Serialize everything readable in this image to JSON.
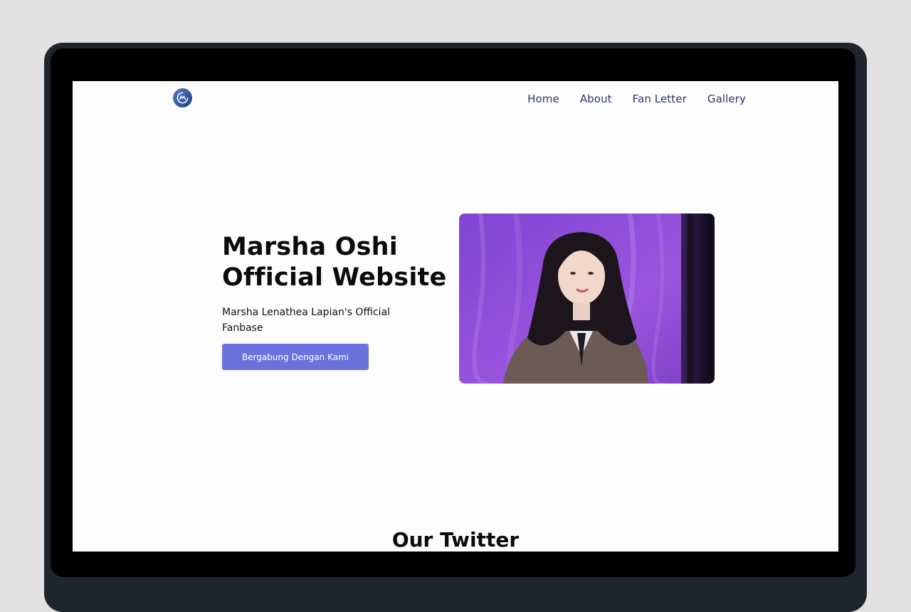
{
  "nav": {
    "items": [
      {
        "label": "Home"
      },
      {
        "label": "About"
      },
      {
        "label": "Fan Letter"
      },
      {
        "label": "Gallery"
      }
    ]
  },
  "hero": {
    "title_line1": "Marsha Oshi",
    "title_line2": "Official Website",
    "subtitle": "Marsha Lenathea Lapian's Official Fanbase",
    "cta_label": "Bergabung Dengan Kami"
  },
  "sections": {
    "twitter_title": "Our Twitter"
  },
  "colors": {
    "accent": "#6b72dc",
    "nav_text": "#2d3564",
    "photo_background": "#8b4fd6"
  },
  "icons": {
    "logo": "site-logo-icon"
  }
}
